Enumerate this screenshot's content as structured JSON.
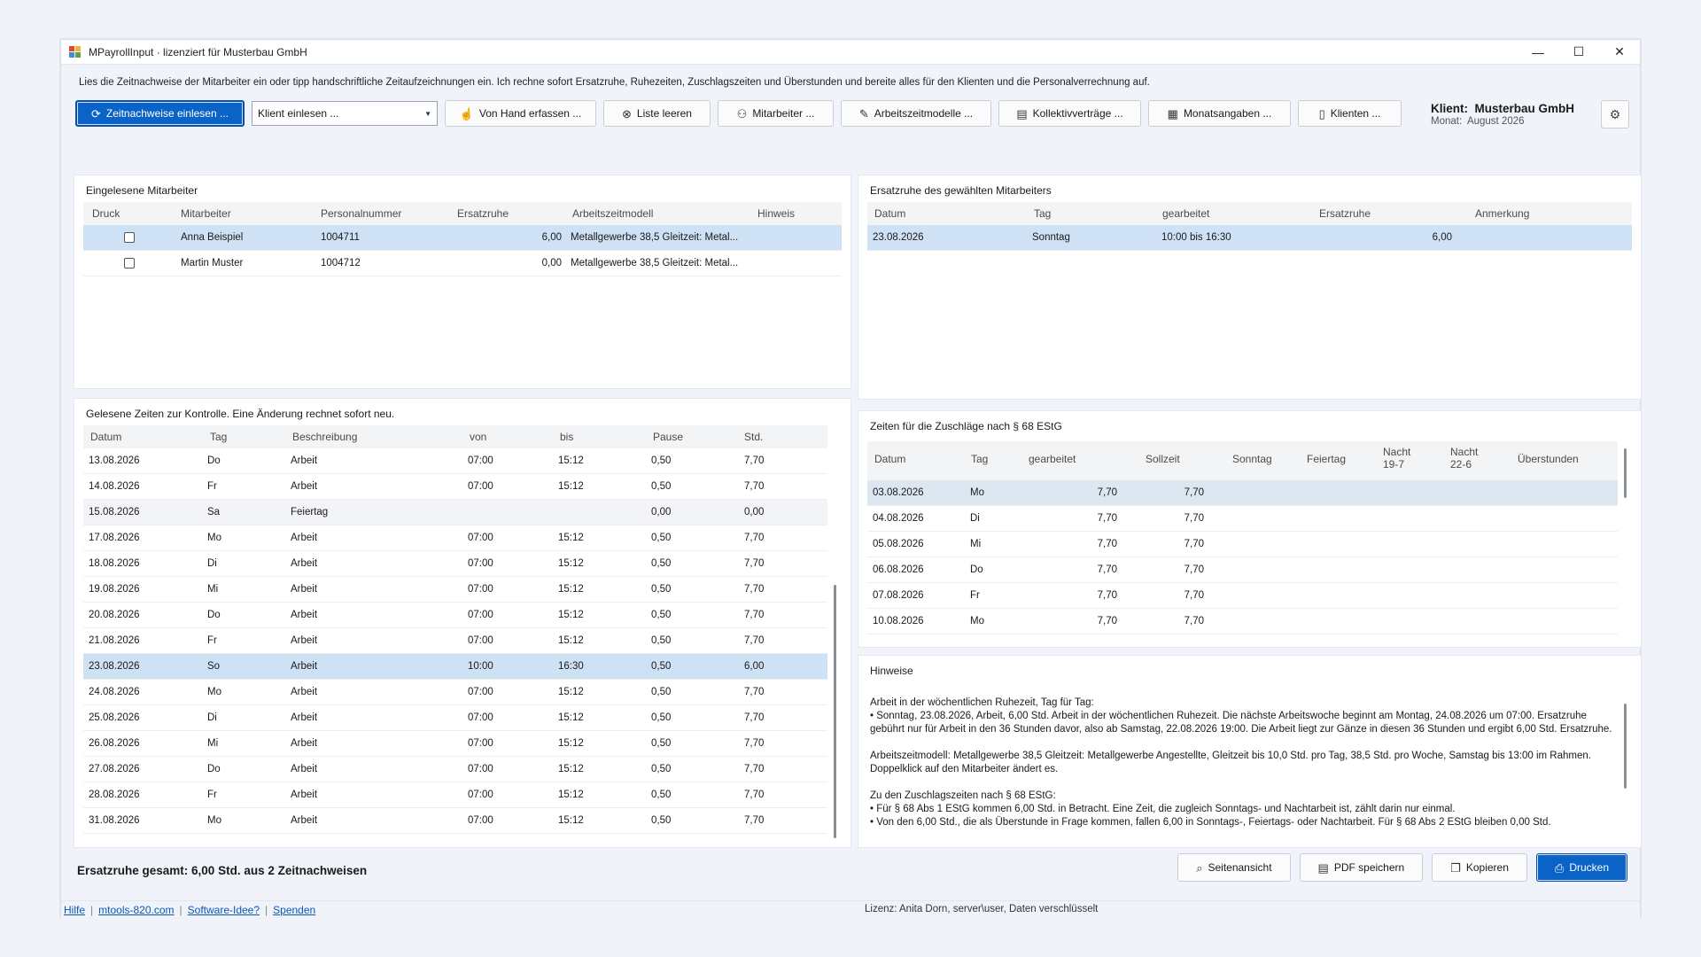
{
  "window": {
    "title": "MPayrollInput · lizenziert für Musterbau GmbH",
    "controls": {
      "minimize": "—",
      "maximize": "☐",
      "close": "✕"
    }
  },
  "instruction": "Lies die Zeitnachweise der Mitarbeiter ein oder tipp handschriftliche Zeitaufzeichnungen ein. Ich rechne sofort Ersatzruhe, Ruhezeiten, Zuschlagszeiten und Überstunden und bereite alles für den Klienten und die Personalverrechnung auf.",
  "toolbar": {
    "read_timesheets": "Zeitnachweise einlesen ...",
    "client_select": "Klient einlesen ...",
    "manual_entry": "Von Hand erfassen ...",
    "clear_list": "Liste leeren",
    "employees": "Mitarbeiter ...",
    "work_models": "Arbeitszeitmodelle ...",
    "collective_agreements": "Kollektivverträge ...",
    "monthly_data": "Monatsangaben ...",
    "clients": "Klienten ..."
  },
  "client": {
    "label": "Klient:",
    "name": "Musterbau GmbH",
    "month_label": "Monat:",
    "month": "August 2026"
  },
  "employees_panel": {
    "title": "Eingelesene Mitarbeiter",
    "headers": [
      "Druck",
      "Mitarbeiter",
      "Personalnummer",
      "Ersatzruhe",
      "Arbeitszeitmodell",
      "Hinweis"
    ],
    "rows": [
      {
        "name": "Anna Beispiel",
        "number": "1004711",
        "rest": "6,00",
        "model": "Metallgewerbe 38,5 Gleitzeit: Metal...",
        "hint": "",
        "selected": true
      },
      {
        "name": "Martin Muster",
        "number": "1004712",
        "rest": "0,00",
        "model": "Metallgewerbe 38,5 Gleitzeit: Metal...",
        "hint": "",
        "selected": false
      }
    ]
  },
  "rest_panel": {
    "title": "Ersatzruhe des gewählten Mitarbeiters",
    "headers": [
      "Datum",
      "Tag",
      "gearbeitet",
      "Ersatzruhe",
      "Anmerkung"
    ],
    "rows": [
      {
        "date": "23.08.2026",
        "day": "Sonntag",
        "worked": "10:00 bis 16:30",
        "rest": "6,00",
        "note": ""
      }
    ]
  },
  "times_panel": {
    "title": "Gelesene Zeiten zur Kontrolle. Eine Änderung rechnet sofort neu.",
    "headers": [
      "Datum",
      "Tag",
      "Beschreibung",
      "von",
      "bis",
      "Pause",
      "Std."
    ],
    "rows": [
      {
        "date": "13.08.2026",
        "day": "Do",
        "desc": "Arbeit",
        "from": "07:00",
        "to": "15:12",
        "pause": "0,50",
        "hours": "7,70"
      },
      {
        "date": "14.08.2026",
        "day": "Fr",
        "desc": "Arbeit",
        "from": "07:00",
        "to": "15:12",
        "pause": "0,50",
        "hours": "7,70"
      },
      {
        "date": "15.08.2026",
        "day": "Sa",
        "desc": "Feiertag",
        "from": "",
        "to": "",
        "pause": "0,00",
        "hours": "0,00"
      },
      {
        "date": "17.08.2026",
        "day": "Mo",
        "desc": "Arbeit",
        "from": "07:00",
        "to": "15:12",
        "pause": "0,50",
        "hours": "7,70"
      },
      {
        "date": "18.08.2026",
        "day": "Di",
        "desc": "Arbeit",
        "from": "07:00",
        "to": "15:12",
        "pause": "0,50",
        "hours": "7,70"
      },
      {
        "date": "19.08.2026",
        "day": "Mi",
        "desc": "Arbeit",
        "from": "07:00",
        "to": "15:12",
        "pause": "0,50",
        "hours": "7,70"
      },
      {
        "date": "20.08.2026",
        "day": "Do",
        "desc": "Arbeit",
        "from": "07:00",
        "to": "15:12",
        "pause": "0,50",
        "hours": "7,70"
      },
      {
        "date": "21.08.2026",
        "day": "Fr",
        "desc": "Arbeit",
        "from": "07:00",
        "to": "15:12",
        "pause": "0,50",
        "hours": "7,70"
      },
      {
        "date": "23.08.2026",
        "day": "So",
        "desc": "Arbeit",
        "from": "10:00",
        "to": "16:30",
        "pause": "0,50",
        "hours": "6,00"
      },
      {
        "date": "24.08.2026",
        "day": "Mo",
        "desc": "Arbeit",
        "from": "07:00",
        "to": "15:12",
        "pause": "0,50",
        "hours": "7,70"
      },
      {
        "date": "25.08.2026",
        "day": "Di",
        "desc": "Arbeit",
        "from": "07:00",
        "to": "15:12",
        "pause": "0,50",
        "hours": "7,70"
      },
      {
        "date": "26.08.2026",
        "day": "Mi",
        "desc": "Arbeit",
        "from": "07:00",
        "to": "15:12",
        "pause": "0,50",
        "hours": "7,70"
      },
      {
        "date": "27.08.2026",
        "day": "Do",
        "desc": "Arbeit",
        "from": "07:00",
        "to": "15:12",
        "pause": "0,50",
        "hours": "7,70"
      },
      {
        "date": "28.08.2026",
        "day": "Fr",
        "desc": "Arbeit",
        "from": "07:00",
        "to": "15:12",
        "pause": "0,50",
        "hours": "7,70"
      },
      {
        "date": "31.08.2026",
        "day": "Mo",
        "desc": "Arbeit",
        "from": "07:00",
        "to": "15:12",
        "pause": "0,50",
        "hours": "7,70"
      }
    ]
  },
  "surcharge_panel": {
    "title": "Zeiten für die Zuschläge nach § 68 EStG",
    "headers": [
      "Datum",
      "Tag",
      "gearbeitet",
      "Sollzeit",
      "Sonntag",
      "Feiertag",
      "Nacht\n19-7",
      "Nacht\n22-6",
      "Überstunden"
    ],
    "rows": [
      {
        "date": "03.08.2026",
        "day": "Mo",
        "worked": "7,70",
        "target": "7,70"
      },
      {
        "date": "04.08.2026",
        "day": "Di",
        "worked": "7,70",
        "target": "7,70"
      },
      {
        "date": "05.08.2026",
        "day": "Mi",
        "worked": "7,70",
        "target": "7,70"
      },
      {
        "date": "06.08.2026",
        "day": "Do",
        "worked": "7,70",
        "target": "7,70"
      },
      {
        "date": "07.08.2026",
        "day": "Fr",
        "worked": "7,70",
        "target": "7,70"
      },
      {
        "date": "10.08.2026",
        "day": "Mo",
        "worked": "7,70",
        "target": "7,70"
      }
    ]
  },
  "hints_panel": {
    "title": "Hinweise",
    "text": "Arbeit in der wöchentlichen Ruhezeit, Tag für Tag:\n• Sonntag, 23.08.2026, Arbeit, 6,00 Std. Arbeit in der wöchentlichen Ruhezeit. Die nächste Arbeitswoche beginnt am Montag, 24.08.2026 um 07:00. Ersatzruhe gebührt nur für Arbeit in den 36 Stunden davor, also ab Samstag, 22.08.2026 19:00. Die Arbeit liegt zur Gänze in diesen 36 Stunden und ergibt 6,00 Std. Ersatzruhe.\n\nArbeitszeitmodell: Metallgewerbe 38,5 Gleitzeit: Metallgewerbe Angestellte, Gleitzeit bis 10,0 Std. pro Tag, 38,5 Std. pro Woche, Samstag bis 13:00 im Rahmen. Doppelklick auf den Mitarbeiter ändert es.\n\nZu den Zuschlagszeiten nach § 68 EStG:\n• Für § 68 Abs 1 EStG kommen 6,00 Std. in Betracht. Eine Zeit, die zugleich Sonntags- und Nachtarbeit ist, zählt darin nur einmal.\n• Von den 6,00 Std., die als Überstunde in Frage kommen, fallen 6,00 in Sonntags-, Feiertags- oder Nachtarbeit. Für § 68 Abs 2 EStG bleiben 0,00 Std."
  },
  "summary": "Ersatzruhe gesamt: 6,00 Std. aus 2 Zeitnachweisen",
  "bottom_buttons": {
    "preview": "Seitenansicht",
    "save_pdf": "PDF speichern",
    "copy": "Kopieren",
    "print": "Drucken"
  },
  "footer": {
    "help": "Hilfe",
    "website": "mtools-820.com",
    "idea": "Software-Idee?",
    "donate": "Spenden",
    "license": "Lizenz: Anita Dorn, server\\user, Daten verschlüsselt"
  },
  "colors": {
    "accent": "#0a63c6",
    "selection": "#cfe1f5",
    "background": "#f0f3f9"
  }
}
